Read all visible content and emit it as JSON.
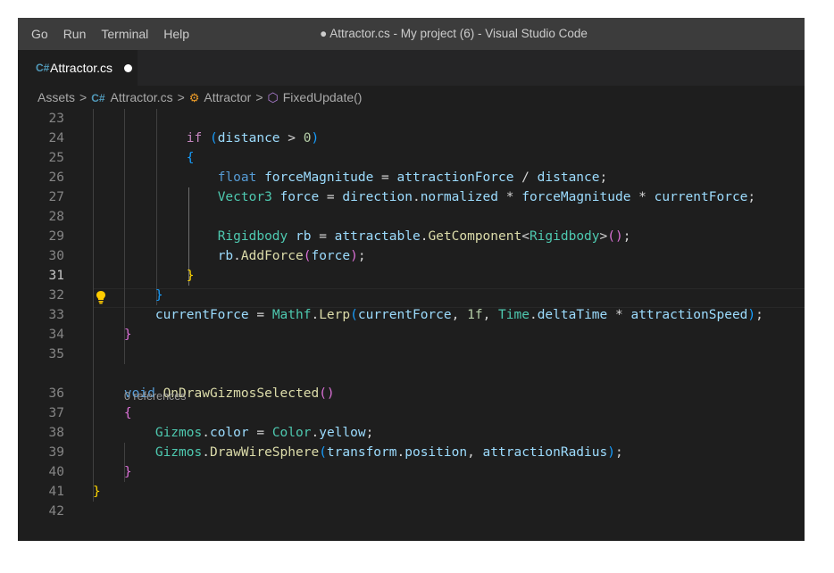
{
  "menu": [
    "Go",
    "Run",
    "Terminal",
    "Help"
  ],
  "window_title": "● Attractor.cs - My project (6) - Visual Studio Code",
  "tab": {
    "icon": "csharp-file-icon",
    "icon_glyph": "C#",
    "label": "Attractor.cs",
    "dirty": true
  },
  "breadcrumb": {
    "folder": "Assets",
    "file": "Attractor.cs",
    "class": "Attractor",
    "method": "FixedUpdate()",
    "separator": ">",
    "class_glyph": "⚙",
    "method_glyph": "⬡"
  },
  "editor": {
    "active_line": 31,
    "codelens": "0 references",
    "lines": [
      {
        "n": "23",
        "tokens": [
          [
            "",
            "",
            ""
          ]
        ]
      },
      {
        "n": "24",
        "tokens": [
          [
            "            ",
            ""
          ],
          [
            "if",
            "ctl"
          ],
          [
            " ",
            ""
          ],
          [
            "(",
            "b3"
          ],
          [
            "distance",
            "var"
          ],
          [
            " > ",
            ""
          ],
          [
            "0",
            "num"
          ],
          [
            ")",
            "b3"
          ]
        ]
      },
      {
        "n": "25",
        "tokens": [
          [
            "            ",
            ""
          ],
          [
            "{",
            "b3"
          ]
        ]
      },
      {
        "n": "26",
        "tokens": [
          [
            "                ",
            ""
          ],
          [
            "float",
            "kw"
          ],
          [
            " ",
            ""
          ],
          [
            "forceMagnitude",
            "var"
          ],
          [
            " = ",
            ""
          ],
          [
            "attractionForce",
            "var"
          ],
          [
            " / ",
            ""
          ],
          [
            "distance",
            "var"
          ],
          [
            ";",
            ""
          ]
        ]
      },
      {
        "n": "27",
        "tokens": [
          [
            "                ",
            ""
          ],
          [
            "Vector3",
            "ty"
          ],
          [
            " ",
            ""
          ],
          [
            "force",
            "var"
          ],
          [
            " = ",
            ""
          ],
          [
            "direction",
            "var"
          ],
          [
            ".",
            ""
          ],
          [
            "normalized",
            "var"
          ],
          [
            " * ",
            ""
          ],
          [
            "forceMagnitude",
            "var"
          ],
          [
            " * ",
            ""
          ],
          [
            "currentForce",
            "var"
          ],
          [
            ";",
            ""
          ]
        ]
      },
      {
        "n": "28",
        "tokens": []
      },
      {
        "n": "29",
        "tokens": [
          [
            "                ",
            ""
          ],
          [
            "Rigidbody",
            "ty"
          ],
          [
            " ",
            ""
          ],
          [
            "rb",
            "var"
          ],
          [
            " = ",
            ""
          ],
          [
            "attractable",
            "var"
          ],
          [
            ".",
            ""
          ],
          [
            "GetComponent",
            "fn"
          ],
          [
            "<",
            ""
          ],
          [
            "Rigidbody",
            "ty"
          ],
          [
            ">",
            ""
          ],
          [
            "()",
            "b2"
          ],
          [
            ";",
            ""
          ]
        ]
      },
      {
        "n": "30",
        "tokens": [
          [
            "                ",
            ""
          ],
          [
            "rb",
            "var"
          ],
          [
            ".",
            ""
          ],
          [
            "AddForce",
            "fn"
          ],
          [
            "(",
            "b2"
          ],
          [
            "force",
            "var"
          ],
          [
            ")",
            "b2"
          ],
          [
            ";",
            ""
          ]
        ]
      },
      {
        "n": "31",
        "tokens": [
          [
            "            ",
            ""
          ],
          [
            "}",
            "b1"
          ]
        ]
      },
      {
        "n": "32",
        "tokens": [
          [
            "        ",
            ""
          ],
          [
            "}",
            "b3"
          ]
        ]
      },
      {
        "n": "33",
        "tokens": [
          [
            "        ",
            ""
          ],
          [
            "currentForce",
            "var"
          ],
          [
            " = ",
            ""
          ],
          [
            "Mathf",
            "ty"
          ],
          [
            ".",
            ""
          ],
          [
            "Lerp",
            "fn"
          ],
          [
            "(",
            "b3"
          ],
          [
            "currentForce",
            "var"
          ],
          [
            ", ",
            ""
          ],
          [
            "1f",
            "num"
          ],
          [
            ", ",
            ""
          ],
          [
            "Time",
            "ty"
          ],
          [
            ".",
            ""
          ],
          [
            "deltaTime",
            "var"
          ],
          [
            " * ",
            ""
          ],
          [
            "attractionSpeed",
            "var"
          ],
          [
            ")",
            "b3"
          ],
          [
            ";",
            ""
          ]
        ]
      },
      {
        "n": "34",
        "tokens": [
          [
            "    ",
            ""
          ],
          [
            "}",
            "b2"
          ]
        ]
      },
      {
        "n": "35",
        "tokens": []
      },
      {
        "n": "36",
        "tokens": [
          [
            "    ",
            ""
          ],
          [
            "void",
            "kw"
          ],
          [
            " ",
            ""
          ],
          [
            "OnDrawGizmosSelected",
            "fn"
          ],
          [
            "()",
            "b2"
          ]
        ]
      },
      {
        "n": "37",
        "tokens": [
          [
            "    ",
            ""
          ],
          [
            "{",
            "b2"
          ]
        ]
      },
      {
        "n": "38",
        "tokens": [
          [
            "        ",
            ""
          ],
          [
            "Gizmos",
            "ty"
          ],
          [
            ".",
            ""
          ],
          [
            "color",
            "var"
          ],
          [
            " = ",
            ""
          ],
          [
            "Color",
            "ty"
          ],
          [
            ".",
            ""
          ],
          [
            "yellow",
            "var"
          ],
          [
            ";",
            ""
          ]
        ]
      },
      {
        "n": "39",
        "tokens": [
          [
            "        ",
            ""
          ],
          [
            "Gizmos",
            "ty"
          ],
          [
            ".",
            ""
          ],
          [
            "DrawWireSphere",
            "fn"
          ],
          [
            "(",
            "b3"
          ],
          [
            "transform",
            "var"
          ],
          [
            ".",
            ""
          ],
          [
            "position",
            "var"
          ],
          [
            ", ",
            ""
          ],
          [
            "attractionRadius",
            "var"
          ],
          [
            ")",
            "b3"
          ],
          [
            ";",
            ""
          ]
        ]
      },
      {
        "n": "40",
        "tokens": [
          [
            "    ",
            ""
          ],
          [
            "}",
            "b2"
          ]
        ]
      },
      {
        "n": "41",
        "tokens": [
          [
            "",
            ""
          ],
          [
            "}",
            "b1"
          ]
        ]
      },
      {
        "n": "42",
        "tokens": []
      }
    ]
  },
  "colors": {
    "editor_bg": "#1e1e1e",
    "titlebar_bg": "#3c3c3c",
    "tabbar_bg": "#252526",
    "keyword": "#569cd6",
    "type": "#4ec9b0",
    "function": "#dcdcaa",
    "variable": "#9cdcfe",
    "number": "#b5cea8",
    "lightbulb": "#ffcc00"
  }
}
